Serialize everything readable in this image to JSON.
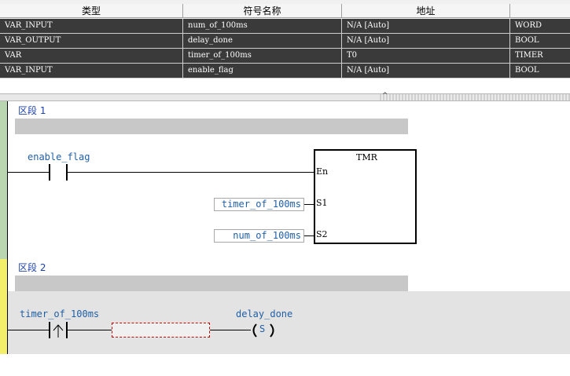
{
  "var_table": {
    "columns": [
      "类型",
      "符号名称",
      "地址",
      "数"
    ],
    "rows": [
      {
        "type": "VAR_INPUT",
        "name": "num_of_100ms",
        "address": "N/A [Auto]",
        "datatype": "WORD"
      },
      {
        "type": "VAR_OUTPUT",
        "name": "delay_done",
        "address": "N/A [Auto]",
        "datatype": "BOOL"
      },
      {
        "type": "VAR",
        "name": "timer_of_100ms",
        "address": "T0",
        "datatype": "TIMER"
      },
      {
        "type": "VAR_INPUT",
        "name": "enable_flag",
        "address": "N/A [Auto]",
        "datatype": "BOOL"
      }
    ]
  },
  "scrollbar_arrow": "^",
  "network1": {
    "title": "区段 1",
    "contact_label": "enable_flag",
    "block_name": "TMR",
    "pins": {
      "en": "En",
      "s1": "S1",
      "s2": "S2"
    },
    "s1_operand": "timer_of_100ms",
    "s2_operand": "num_of_100ms"
  },
  "network2": {
    "title": "区段 2",
    "contact_label": "timer_of_100ms",
    "coil_label": "delay_done",
    "coil_symbol": "S"
  },
  "colors": {
    "rail_network1": "#b9d6b0",
    "rail_network2": "#f3ef6a",
    "label_blue": "#1f5fa8",
    "row_dark": "#3a3a3a"
  }
}
